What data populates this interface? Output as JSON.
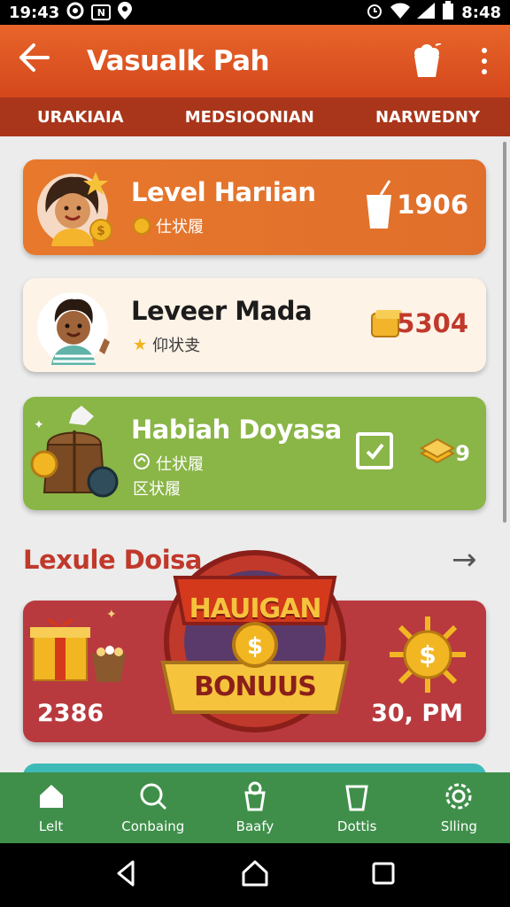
{
  "status_bar": {
    "left_text": "19:43",
    "time": "8:48"
  },
  "app_bar": {
    "title": "Vasualk Pah"
  },
  "tabs": [
    {
      "label": "URAKIAIA"
    },
    {
      "label": "MEDSIOONIAN"
    },
    {
      "label": "NARWEDNY"
    }
  ],
  "cards": [
    {
      "name": "Level Harıian",
      "sub": "仕状履",
      "value": "1906"
    },
    {
      "name": "Leveer Mada",
      "sub": "仰状叏",
      "value": "5304"
    },
    {
      "name": "Habiah Doyasa",
      "sub": "仕状履",
      "sub2": "区状履",
      "value": "9"
    }
  ],
  "section": {
    "title": "Lexule Doisa"
  },
  "bonus": {
    "badge_top": "HAUIGAN",
    "badge_bottom": "BONUUS",
    "left_value": "2386",
    "right_value": "30, PM"
  },
  "bottom_nav": [
    {
      "label": "Lelt"
    },
    {
      "label": "Conbaing"
    },
    {
      "label": "Baafy"
    },
    {
      "label": "Dottis"
    },
    {
      "label": "Slling"
    }
  ],
  "colors": {
    "app_bar": "#e0582a",
    "tabs": "#a9361a",
    "bottom_nav": "#3f8f4a",
    "bonus": "#b83a3f"
  }
}
